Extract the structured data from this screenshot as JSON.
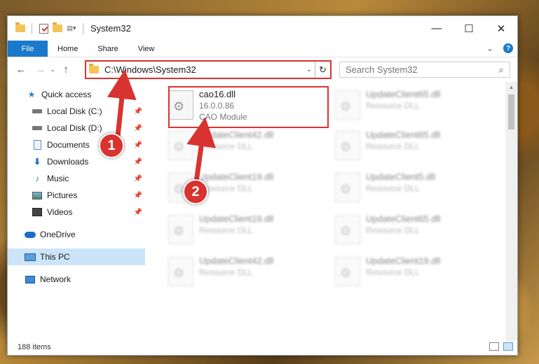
{
  "window": {
    "title": "System32",
    "controls": {
      "minimize": "—",
      "maximize": "☐",
      "close": "✕"
    }
  },
  "ribbon": {
    "tabs": [
      "File",
      "Home",
      "Share",
      "View"
    ],
    "expand": "⌄",
    "help": "?"
  },
  "address": {
    "path": "C:\\Windows\\System32",
    "dropdown": "⌄",
    "refresh": "↻"
  },
  "search": {
    "placeholder": "Search System32",
    "icon": "⌕"
  },
  "nav_buttons": {
    "back": "←",
    "forward": "→",
    "recent": "⌄",
    "up": "↑"
  },
  "sidebar": {
    "items": [
      {
        "label": "Quick access",
        "icon": "star-icon"
      },
      {
        "label": "Local Disk (C:)",
        "icon": "drive-icon",
        "pinned": true
      },
      {
        "label": "Local Disk (D:)",
        "icon": "drive-icon",
        "pinned": true
      },
      {
        "label": "Documents",
        "icon": "documents-icon",
        "pinned": true
      },
      {
        "label": "Downloads",
        "icon": "downloads-icon",
        "pinned": true
      },
      {
        "label": "Music",
        "icon": "music-icon",
        "pinned": true
      },
      {
        "label": "Pictures",
        "icon": "pictures-icon",
        "pinned": true
      },
      {
        "label": "Videos",
        "icon": "videos-icon",
        "pinned": true
      },
      {
        "label": "OneDrive",
        "icon": "onedrive-icon"
      },
      {
        "label": "This PC",
        "icon": "pc-icon",
        "selected": true
      },
      {
        "label": "Network",
        "icon": "network-icon"
      }
    ]
  },
  "files": [
    {
      "name": "cao16.dll",
      "version": "16.0.0.86",
      "description": "CAO Module",
      "highlighted": true
    },
    {
      "name": "UpdateClient65.dll",
      "description": "Resource DLL"
    },
    {
      "name": "UpdateClient42.dll",
      "description": "Resource DLL"
    },
    {
      "name": "UpdateClient65.dll",
      "description": "Resource DLL"
    },
    {
      "name": "UpdateClient19.dll",
      "description": "Resource DLL"
    },
    {
      "name": "UpdateClient5.dll",
      "description": "Resource DLL"
    },
    {
      "name": "UpdateClient19.dll",
      "description": "Resource DLL"
    },
    {
      "name": "UpdateClient65.dll",
      "description": "Resource DLL"
    },
    {
      "name": "UpdateClient42.dll",
      "description": "Resource DLL"
    },
    {
      "name": "UpdateClient19.dll",
      "description": "Resource DLL"
    }
  ],
  "status": {
    "item_count": "188 items"
  },
  "annotations": [
    "1",
    "2"
  ],
  "colors": {
    "accent": "#1979ca",
    "highlight_red": "#d9332f",
    "selected": "#cce4f7"
  }
}
